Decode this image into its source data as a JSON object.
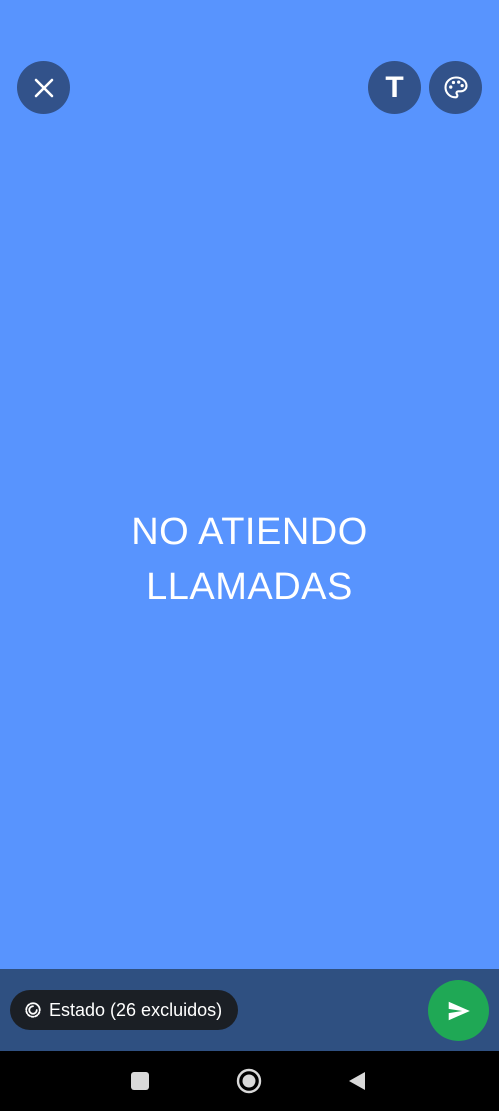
{
  "top_controls": {
    "close_icon": "close-icon",
    "text_tool_glyph": "T",
    "palette_icon": "palette-icon"
  },
  "status": {
    "text": "NO ATIENDO\nLLAMADAS",
    "background_color": "#5894FE",
    "text_color": "#FFFFFF"
  },
  "bottom_bar": {
    "audience_label": "Estado (26 excluidos)",
    "audience_icon": "status-icon",
    "send_icon": "send-icon",
    "send_color": "#1FA855"
  },
  "nav": {
    "recents_icon": "square-icon",
    "home_icon": "circle-icon",
    "back_icon": "triangle-back-icon"
  }
}
